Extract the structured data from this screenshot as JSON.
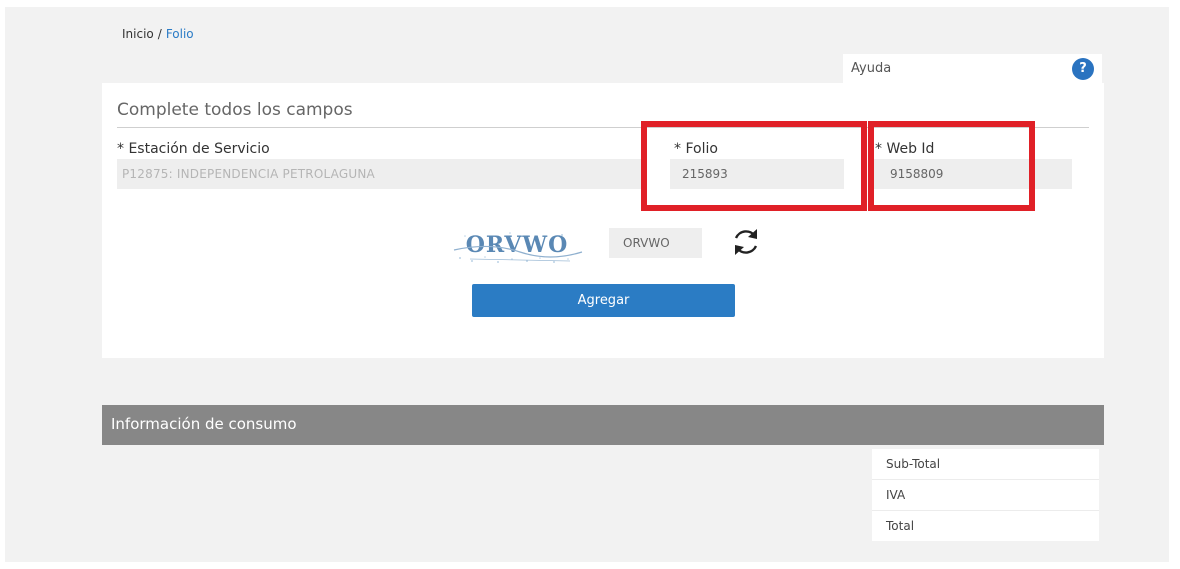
{
  "breadcrumb": {
    "home": "Inicio",
    "separator": "/",
    "current": "Folio"
  },
  "help": {
    "label": "Ayuda",
    "icon_text": "?"
  },
  "form": {
    "title": "Complete todos los campos",
    "station": {
      "label": "* Estación de Servicio",
      "value": "P12875: INDEPENDENCIA PETROLAGUNA"
    },
    "folio": {
      "label": "* Folio",
      "value": "215893"
    },
    "web_id": {
      "label": "* Web Id",
      "value": "9158809"
    },
    "captcha": {
      "image_text": "ORVWO",
      "input_value": "ORVWO"
    },
    "submit_label": "Agregar"
  },
  "consumption": {
    "title": "Información de consumo",
    "totals": [
      {
        "label": "Sub-Total"
      },
      {
        "label": "IVA"
      },
      {
        "label": "Total"
      }
    ]
  },
  "colors": {
    "accent": "#2b7cc4",
    "highlight": "#e02027",
    "section_bar": "#878787",
    "background": "#f2f2f2"
  }
}
